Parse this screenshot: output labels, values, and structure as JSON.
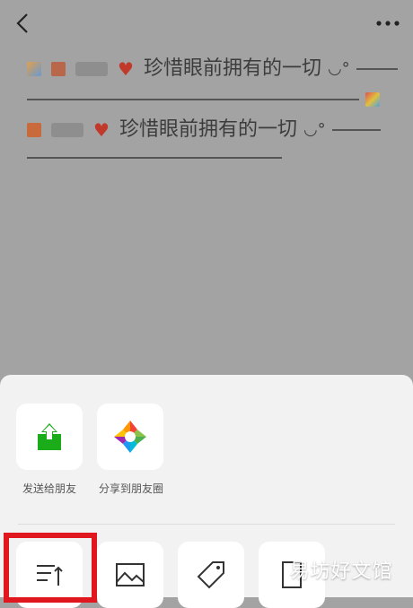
{
  "nav": {
    "back_icon": "chevron-left-icon",
    "more_icon": "more-dots-icon"
  },
  "post": {
    "line1_text": "珍惜眼前拥有的一切",
    "line3_text": "珍惜眼前拥有的一切",
    "smile": "◡°"
  },
  "share_sheet": {
    "row1": [
      {
        "label": "发送给朋友",
        "icon": "share-upload-icon",
        "color": "#1aad19"
      },
      {
        "label": "分享到朋友圈",
        "icon": "moments-camera-icon",
        "color": ""
      }
    ],
    "row2": [
      {
        "icon": "sort-icon"
      },
      {
        "icon": "image-icon"
      },
      {
        "icon": "tag-icon"
      },
      {
        "icon": "document-icon"
      }
    ]
  },
  "watermark": {
    "text": "易坊好文馆"
  },
  "colors": {
    "overlay": "#a3a3a3",
    "sheet": "#f2f2f2",
    "accent_green": "#1aad19",
    "highlight_red": "#e0171f"
  }
}
